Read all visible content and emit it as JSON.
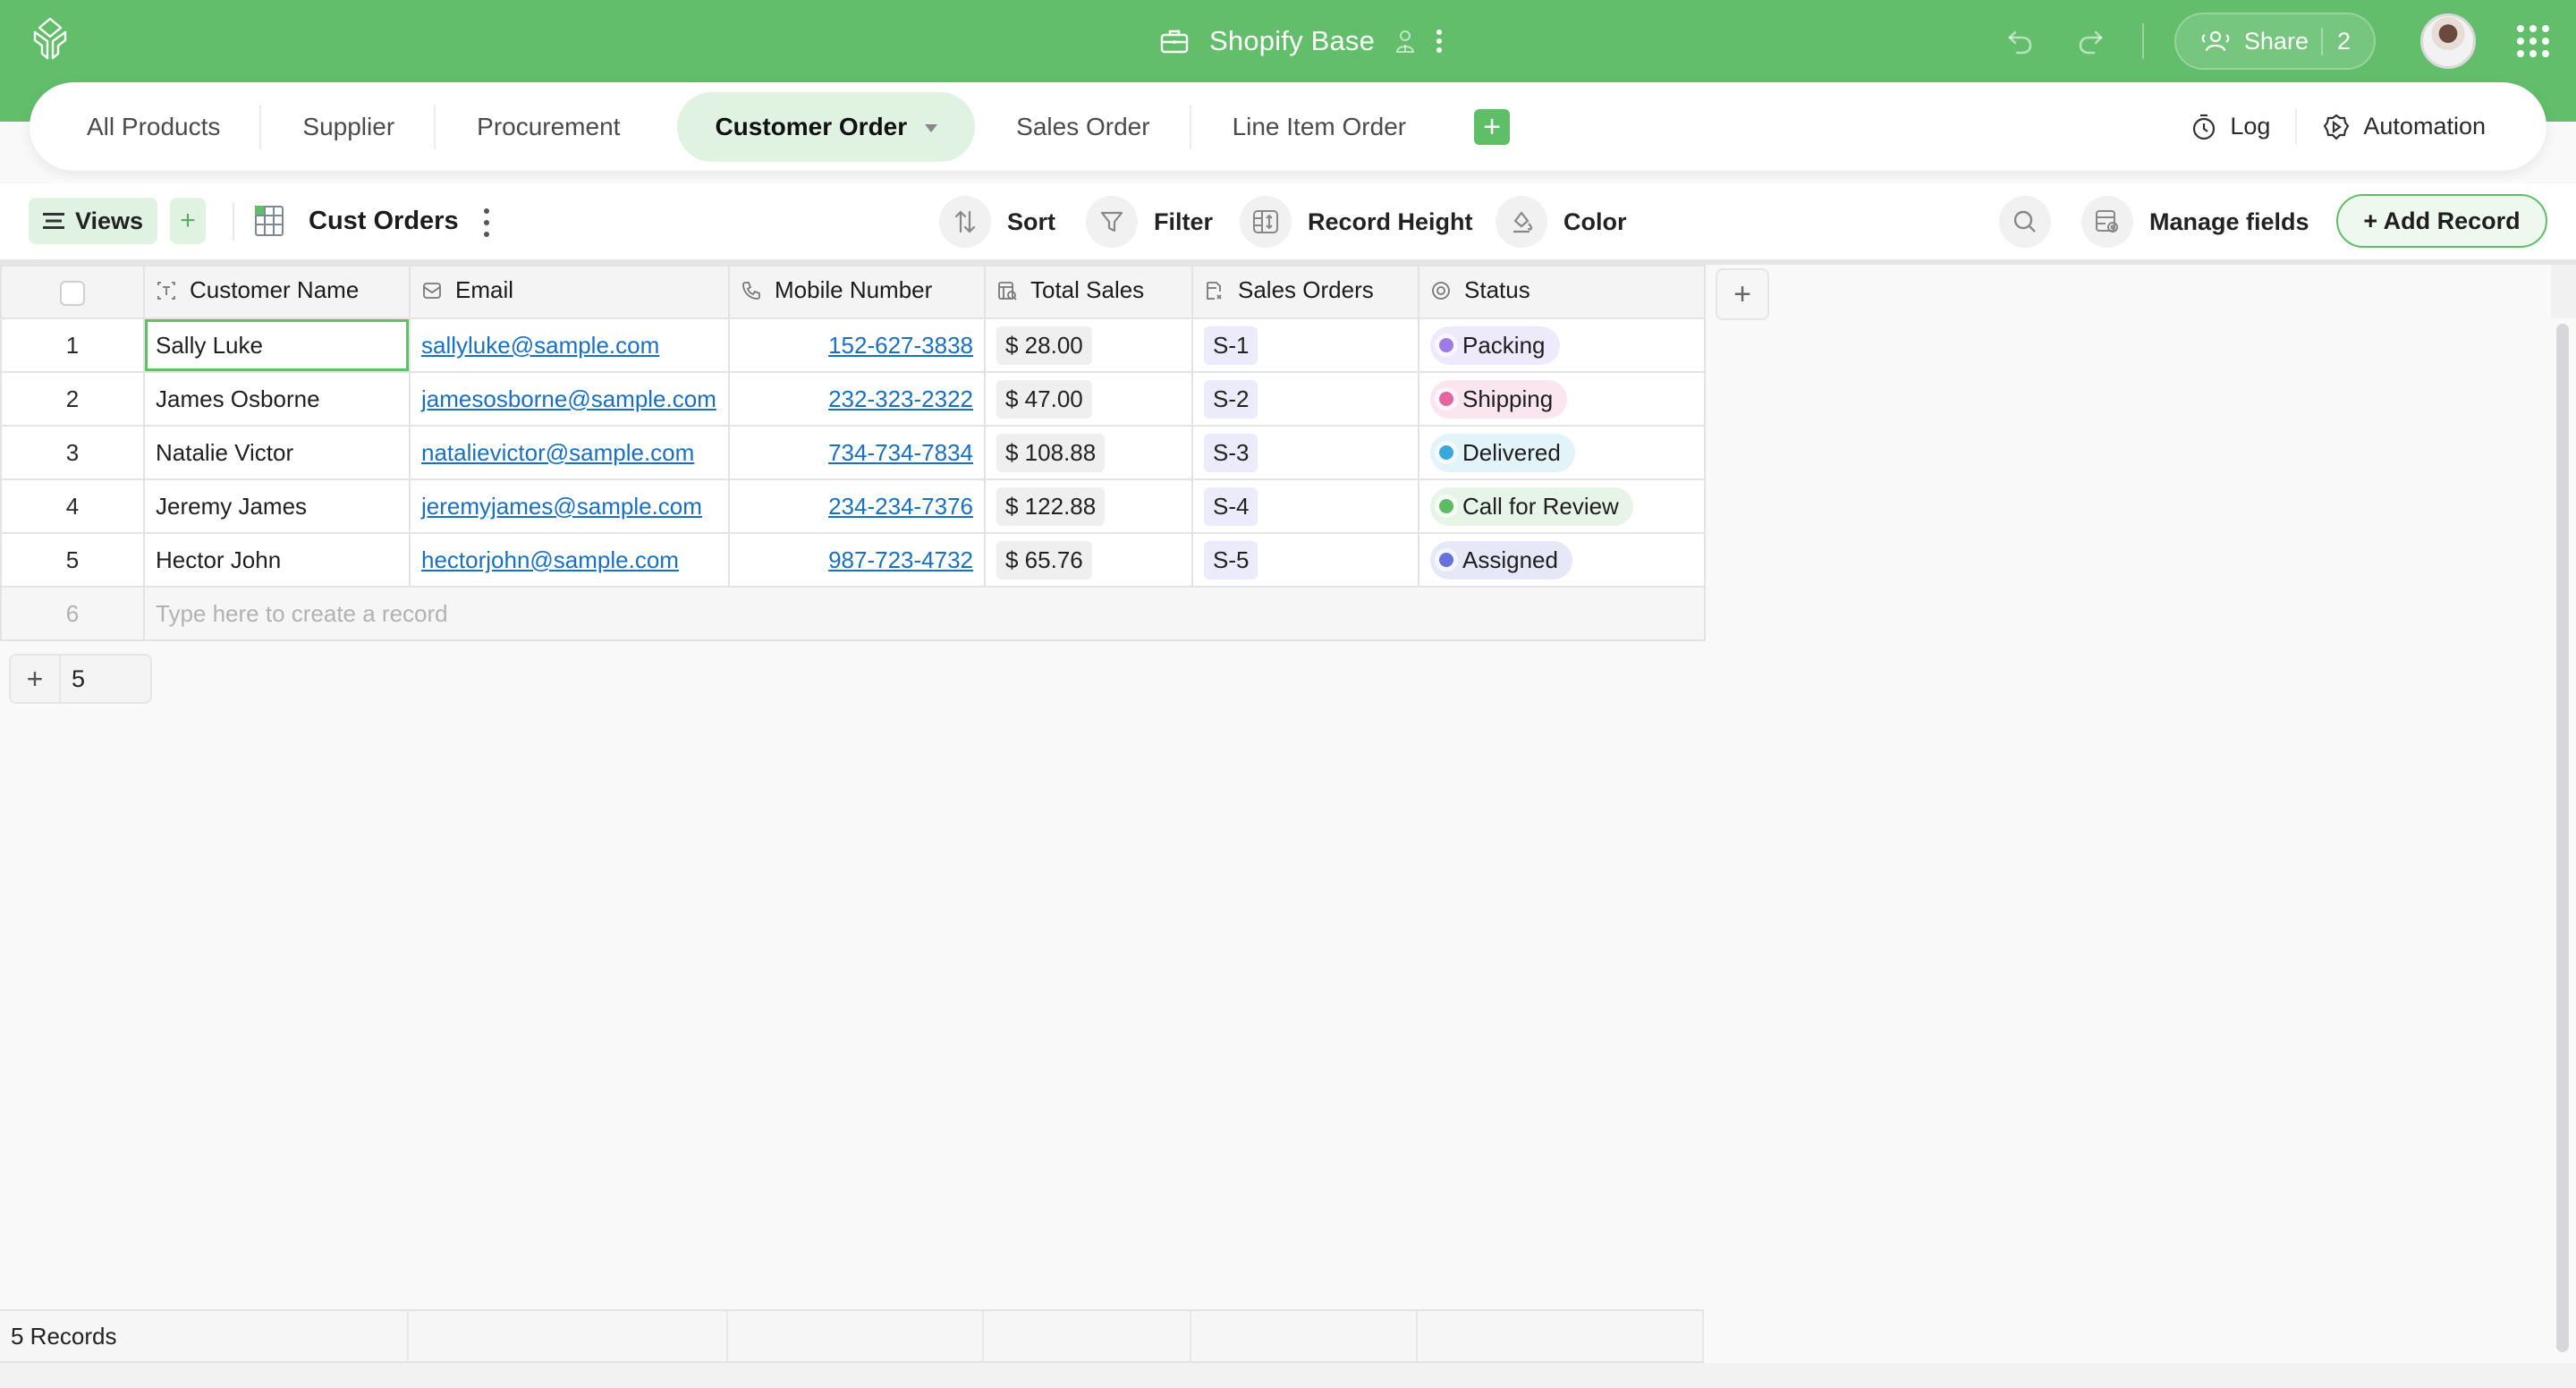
{
  "header": {
    "base_title": "Shopify Base",
    "share_label": "Share",
    "share_count": "2",
    "accent_color": "#63be6c"
  },
  "tabs": [
    {
      "label": "All Products",
      "active": false
    },
    {
      "label": "Supplier",
      "active": false
    },
    {
      "label": "Procurement",
      "active": false
    },
    {
      "label": "Customer Order",
      "active": true
    },
    {
      "label": "Sales Order",
      "active": false
    },
    {
      "label": "Line Item Order",
      "active": false
    }
  ],
  "tab_actions": {
    "log_label": "Log",
    "automation_label": "Automation"
  },
  "toolbar": {
    "views_label": "Views",
    "view_name": "Cust Orders",
    "sort_label": "Sort",
    "filter_label": "Filter",
    "record_height_label": "Record Height",
    "color_label": "Color",
    "manage_fields_label": "Manage fields",
    "add_record_label": "+ Add Record"
  },
  "table": {
    "columns": [
      {
        "label": "Customer Name",
        "icon": "text-field-icon"
      },
      {
        "label": "Email",
        "icon": "email-icon"
      },
      {
        "label": "Mobile Number",
        "icon": "phone-icon"
      },
      {
        "label": "Total Sales",
        "icon": "rollup-icon"
      },
      {
        "label": "Sales Orders",
        "icon": "link-record-icon"
      },
      {
        "label": "Status",
        "icon": "single-select-icon"
      }
    ],
    "rows": [
      {
        "num": "1",
        "name": "Sally Luke",
        "email": "sallyluke@sample.com",
        "phone": "152-627-3838",
        "total": "$ 28.00",
        "order": "S-1",
        "status": "Packing",
        "status_color": "#9b7be8",
        "status_bg": "#efeafb"
      },
      {
        "num": "2",
        "name": "James Osborne",
        "email": "jamesosborne@sample.com",
        "phone": "232-323-2322",
        "total": "$ 47.00",
        "order": "S-2",
        "status": "Shipping",
        "status_color": "#e5659f",
        "status_bg": "#fbe6ef"
      },
      {
        "num": "3",
        "name": "Natalie Victor",
        "email": "natalievictor@sample.com",
        "phone": "734-734-7834",
        "total": "$ 108.88",
        "order": "S-3",
        "status": "Delivered",
        "status_color": "#3aa9d9",
        "status_bg": "#e2f3fa"
      },
      {
        "num": "4",
        "name": "Jeremy James",
        "email": "jeremyjames@sample.com",
        "phone": "234-234-7376",
        "total": "$ 122.88",
        "order": "S-4",
        "status": "Call for Review",
        "status_color": "#5dbb63",
        "status_bg": "#e6f5e7"
      },
      {
        "num": "5",
        "name": "Hector John",
        "email": "hectorjohn@sample.com",
        "phone": "987-723-4732",
        "total": "$ 65.76",
        "order": "S-5",
        "status": "Assigned",
        "status_color": "#6673dc",
        "status_bg": "#e6e8f8"
      }
    ],
    "new_row_num": "6",
    "new_row_placeholder": "Type here to create a record",
    "add_rows_count": "5",
    "footer_count": "5 Records"
  }
}
